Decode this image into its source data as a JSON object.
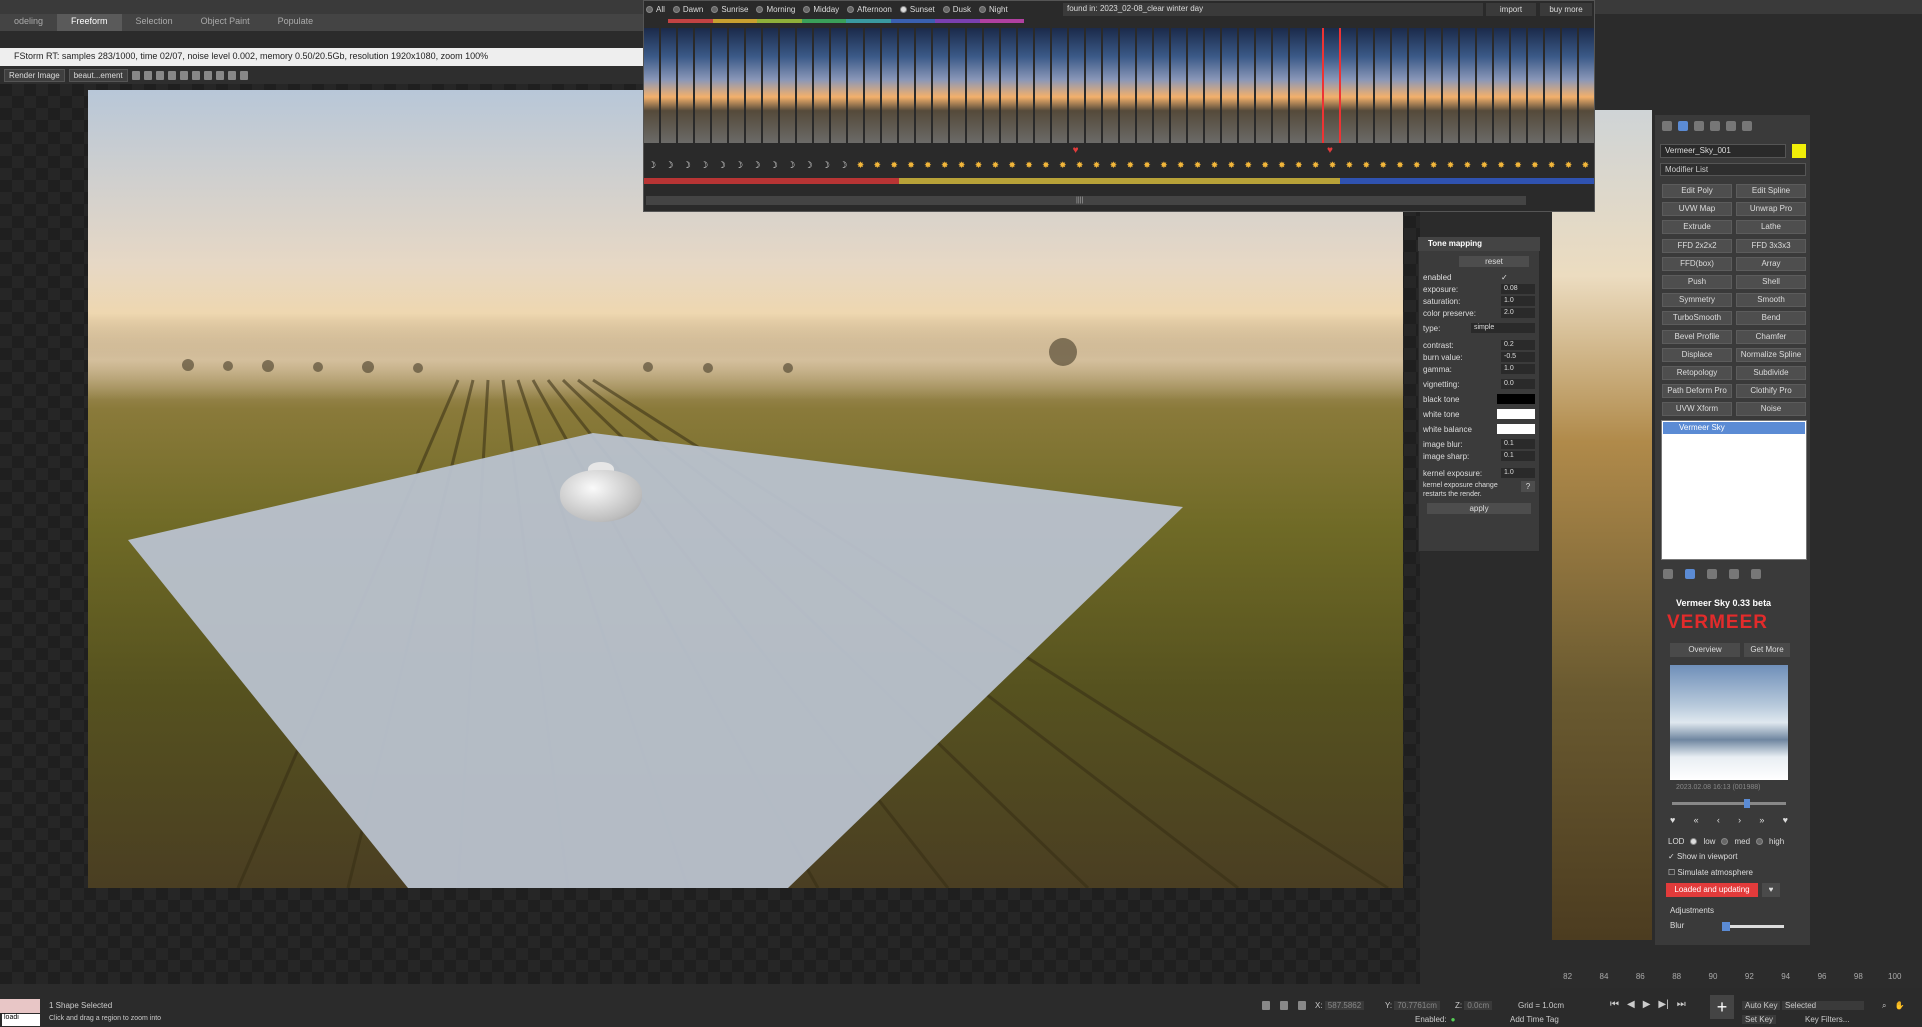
{
  "ribbon": {
    "tabs": [
      "odeling",
      "Freeform",
      "Selection",
      "Object Paint",
      "Populate"
    ]
  },
  "frame_buffer": {
    "title": "FStorm RT: samples 283/1000, time 02/07, noise level 0.002, memory 0.50/20.5Gb, resolution 1920x1080, zoom 100%",
    "channel_select": "Render Image",
    "element_select": "beaut...ement"
  },
  "sky_strip": {
    "filters": [
      "All",
      "Dawn",
      "Sunrise",
      "Morning",
      "Midday",
      "Afternoon",
      "Sunset",
      "Dusk",
      "Night"
    ],
    "selected_filter": "Sunset",
    "found_label": "found in:",
    "found_value": "2023_02-08_clear winter day",
    "import": "import",
    "buy_more": "buy more",
    "thumbnail_count": 56,
    "selected_index": 40,
    "favorite_indices": [
      25,
      40
    ],
    "moon_count": 12,
    "colors": {
      "red": "#b83434",
      "yellow": "#b8a238",
      "blue": "#2f52b0",
      "accent": "#e23b3b"
    }
  },
  "tone_mapping": {
    "title": "Tone mapping",
    "reset": "reset",
    "rows": [
      {
        "label": "enabled",
        "value": "✓"
      },
      {
        "label": "exposure:",
        "value": "0.08"
      },
      {
        "label": "saturation:",
        "value": "1.0"
      },
      {
        "label": "color preserve:",
        "value": "2.0"
      },
      {
        "label": "type:",
        "value": "simple"
      },
      {
        "label": "contrast:",
        "value": "0.2"
      },
      {
        "label": "burn value:",
        "value": "-0.5"
      },
      {
        "label": "gamma:",
        "value": "1.0"
      },
      {
        "label": "vignetting:",
        "value": "0.0"
      },
      {
        "label": "black tone",
        "value": ""
      },
      {
        "label": "white tone",
        "value": ""
      },
      {
        "label": "white balance",
        "value": ""
      },
      {
        "label": "image blur:",
        "value": "0.1"
      },
      {
        "label": "image sharp:",
        "value": "0.1"
      },
      {
        "label": "kernel exposure:",
        "value": "1.0"
      }
    ],
    "kernel_note": "kernel exposure change restarts the render.",
    "help": "?",
    "apply": "apply"
  },
  "command_panel": {
    "object_name": "Vermeer_Sky_001",
    "modifier_list": "Modifier List",
    "modifiers": [
      [
        "Edit Poly",
        "Edit Spline"
      ],
      [
        "UVW Map",
        "Unwrap Pro"
      ],
      [
        "Extrude",
        "Lathe"
      ],
      [
        "FFD 2x2x2",
        "FFD 3x3x3"
      ],
      [
        "FFD(box)",
        "Array"
      ],
      [
        "Push",
        "Shell"
      ],
      [
        "Symmetry",
        "Smooth"
      ],
      [
        "TurboSmooth",
        "Bend"
      ],
      [
        "Bevel Profile",
        "Chamfer"
      ],
      [
        "Displace",
        "Normalize Spline"
      ],
      [
        "Retopology",
        "Subdivide"
      ],
      [
        "Path Deform Pro",
        "Clothify Pro"
      ],
      [
        "UVW Xform",
        "Noise"
      ]
    ],
    "stack_item": "Vermeer Sky"
  },
  "vermeer": {
    "header": "Vermeer Sky 0.33 beta",
    "logo": "VERMEER",
    "overview": "Overview",
    "get_more": "Get More",
    "date": "2023.02.08 16:13 (001988)",
    "lod_label": "LOD",
    "lod_low": "low",
    "lod_med": "med",
    "lod_high": "high",
    "show_in_viewport": "Show in viewport",
    "simulate_atmosphere": "Simulate atmosphere",
    "loaded": "Loaded and updating",
    "adjustments": "Adjustments",
    "blur": "Blur"
  },
  "timeline": {
    "ticks": [
      "82",
      "84",
      "86",
      "88",
      "90",
      "92",
      "94",
      "96",
      "98",
      "100"
    ]
  },
  "status": {
    "selection": "1 Shape Selected",
    "prompt": "Click and drag a region to zoom into",
    "x_label": "X:",
    "x_value": "587.5862",
    "y_label": "Y:",
    "y_value": "70.7761cm",
    "z_label": "Z:",
    "z_value": "0.0cm",
    "grid": "Grid = 1.0cm",
    "auto_key": "Auto Key",
    "selected": "Selected",
    "set_key": "Set Key",
    "key_filters": "Key Filters...",
    "enabled": "Enabled:",
    "add_time_tag": "Add Time Tag",
    "maxscript": "loadi"
  }
}
